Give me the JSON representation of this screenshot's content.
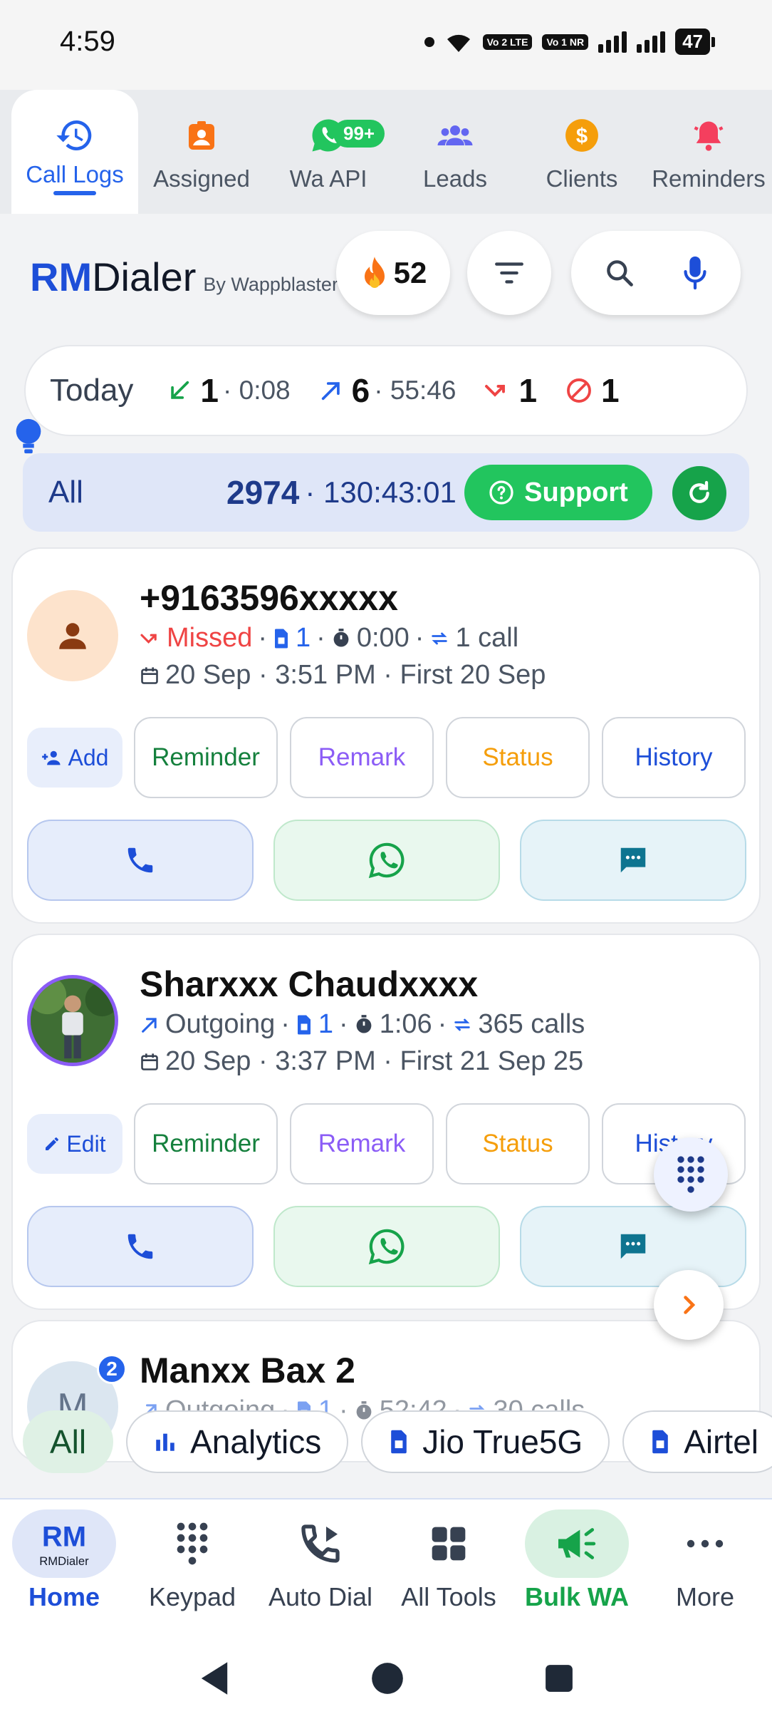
{
  "status_bar": {
    "time": "4:59",
    "battery": "47",
    "volte1": "Vo 2 LTE",
    "volte2": "Vo 1 NR"
  },
  "top_tabs": [
    {
      "label": "Call Logs",
      "icon": "history-icon",
      "active": true
    },
    {
      "label": "Assigned",
      "icon": "badge-icon"
    },
    {
      "label": "Wa API",
      "icon": "whatsapp-icon",
      "badge": "99+"
    },
    {
      "label": "Leads",
      "icon": "group-icon"
    },
    {
      "label": "Clients",
      "icon": "dollar-icon"
    },
    {
      "label": "Reminders",
      "icon": "bell-icon"
    }
  ],
  "header": {
    "brand_rm": "RM",
    "brand_dialer": "Dialer",
    "brand_by": "By Wappblaster",
    "streak": "52"
  },
  "today": {
    "label": "Today",
    "incoming_count": "1",
    "incoming_dur": "· 0:08",
    "outgoing_count": "6",
    "outgoing_dur": "· 55:46",
    "missed_count": "1",
    "blocked_count": "1"
  },
  "allbar": {
    "label": "All",
    "count": "2974",
    "duration": "· 130:43:01",
    "support": "Support"
  },
  "cards": [
    {
      "name": "+9163596xxxxx",
      "type": "Missed",
      "sim": "1",
      "duration": "0:00",
      "calls": "1 call",
      "date": "20 Sep · 3:51 PM · First 20 Sep",
      "left_button": "Add"
    },
    {
      "name": "Sharxxx Chaudxxxx",
      "type": "Outgoing",
      "sim": "1",
      "duration": "1:06",
      "calls": "365 calls",
      "date": "20 Sep · 3:37 PM · First 21 Sep 25",
      "left_button": "Edit"
    },
    {
      "name": "Manxx Bax 2",
      "type": "Outgoing",
      "sim": "1",
      "duration": "52:42",
      "calls": "30 calls",
      "avatar_letter": "M",
      "badge": "2"
    }
  ],
  "action_labels": {
    "reminder": "Reminder",
    "remark": "Remark",
    "status": "Status",
    "history": "History"
  },
  "chips": [
    "All",
    "Analytics",
    "Jio True5G",
    "Airtel"
  ],
  "bottom_nav": [
    {
      "label": "Home"
    },
    {
      "label": "Keypad"
    },
    {
      "label": "Auto Dial"
    },
    {
      "label": "All Tools"
    },
    {
      "label": "Bulk WA"
    },
    {
      "label": "More"
    }
  ],
  "colors": {
    "primary": "#2563eb",
    "green": "#22c55e",
    "missed": "#ef4444",
    "remark": "#8b5cf6",
    "status": "#f59e0b",
    "reminder": "#15803d"
  }
}
